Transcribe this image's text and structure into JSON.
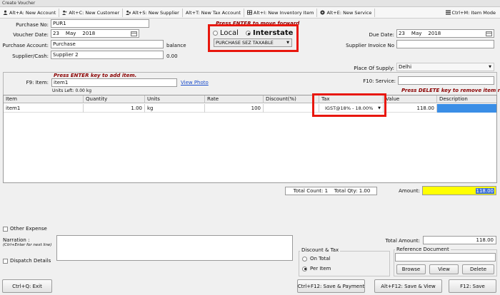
{
  "window": {
    "title": "Create Voucher"
  },
  "toolbar": {
    "items": [
      {
        "label": "Alt+A: New Account",
        "icon": "user-icon"
      },
      {
        "label": "Alt+C: New Customer",
        "icon": "customer-icon"
      },
      {
        "label": "Alt+S: New Supplier",
        "icon": "supplier-icon"
      },
      {
        "label": "Alt+T: New Tax Account",
        "icon": ""
      },
      {
        "label": "Alt+I: New Inventory Item",
        "icon": "inventory-icon"
      },
      {
        "label": "Alt+E: New Service",
        "icon": "service-icon"
      }
    ],
    "item_mode": "Ctrl+M: Item Mode"
  },
  "header": {
    "purchase_no_label": "Purchase No:",
    "purchase_no": "PUR1",
    "voucher_date_label": "Voucher Date:",
    "voucher_date": {
      "day": "23",
      "month": "May",
      "year": "2018"
    },
    "purchase_account_label": "Purchase Account:",
    "purchase_account": "Purchase",
    "balance_label": "balance",
    "supplier_label": "Supplier/Cash:",
    "supplier": "Supplier 2",
    "supplier_balance": "0.00",
    "enter_note": "Press ENTER to move forward",
    "local_label": "Local",
    "interstate_label": "Interstate",
    "tax_type": "PURCHASE SEZ TAXABLE",
    "due_date_label": "Due Date:",
    "due_date": {
      "day": "23",
      "month": "May",
      "year": "2018"
    },
    "supplier_invoice_label": "Supplier Invoice No",
    "supplier_invoice": "",
    "place_of_supply_label": "Place Of Supply:",
    "place_of_supply": "Delhi"
  },
  "items_section": {
    "add_note": "Press ENTER key to add item.",
    "item_label": "F9: Item:",
    "item_value": "item1",
    "view_photo": "View Photo",
    "units_left": "Units Left: 0.00 kg",
    "service_label": "F10: Service:",
    "service_value": "",
    "remove_note": "Press DELETE key to remove item row."
  },
  "grid": {
    "columns": [
      "Item",
      "Quantity",
      "Units",
      "Rate",
      "Discount(%)",
      "Tax",
      "Value",
      "Description"
    ],
    "rows": [
      {
        "item": "item1",
        "quantity": "1.00",
        "units": "kg",
        "rate": "100",
        "discount": "",
        "tax": "IGST@18% - 18.00%",
        "value": "118.00",
        "description": ""
      }
    ]
  },
  "totals": {
    "total_count": "Total Count: 1",
    "total_qty": "Total Qty: 1.00",
    "amount_label": "Amount:",
    "amount": "118.00",
    "total_amount_label": "Total Amount:",
    "total_amount": "118.00"
  },
  "footer": {
    "other_expense": "Other Expense",
    "narration_label": "Narration :",
    "narration_hint": "(Ctrl+Enter for next line)",
    "narration": "",
    "dispatch_details": "Dispatch Details",
    "discount_tax_title": "Discount & Tax",
    "on_total": "On Total",
    "per_item": "Per Item",
    "reference_document_title": "Reference Document",
    "browse": "Browse",
    "view": "View",
    "delete": "Delete"
  },
  "buttons": {
    "exit": "Ctrl+Q: Exit",
    "save_payment": "Ctrl+F12: Save & Payment",
    "save_view": "Alt+F12: Save & View",
    "save": "F12: Save"
  },
  "colors": {
    "highlight": "#ffff00",
    "red_box": "#e8170d",
    "note_red": "#8b0000",
    "selection": "#3a8ee6"
  }
}
